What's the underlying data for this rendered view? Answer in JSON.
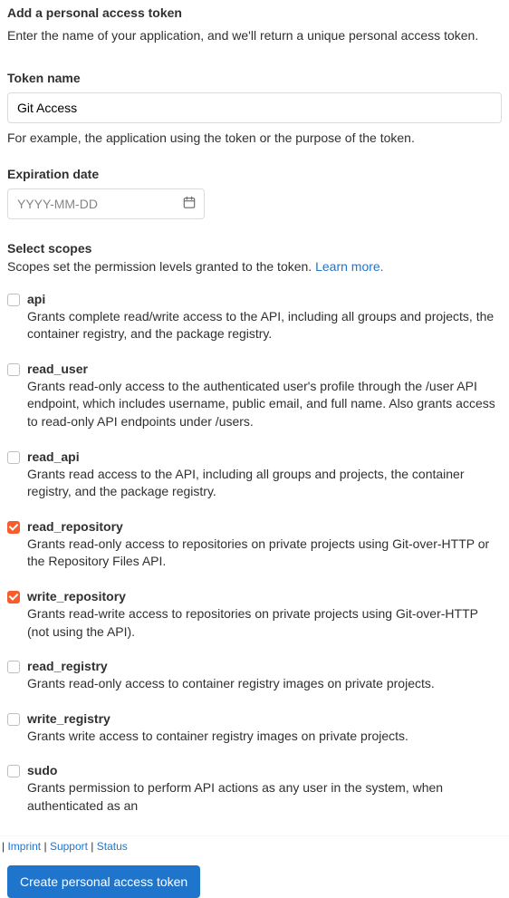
{
  "heading": "Add a personal access token",
  "intro": "Enter the name of your application, and we'll return a unique personal access token.",
  "token_name": {
    "label": "Token name",
    "value": "Git Access",
    "help": "For example, the application using the token or the purpose of the token."
  },
  "expiration": {
    "label": "Expiration date",
    "placeholder": "YYYY-MM-DD"
  },
  "scopes": {
    "label": "Select scopes",
    "desc_prefix": "Scopes set the permission levels granted to the token. ",
    "learn_more": "Learn more.",
    "items": [
      {
        "name": "api",
        "checked": false,
        "desc": "Grants complete read/write access to the API, including all groups and projects, the container registry, and the package registry."
      },
      {
        "name": "read_user",
        "checked": false,
        "desc": "Grants read-only access to the authenticated user's profile through the /user API endpoint, which includes username, public email, and full name. Also grants access to read-only API endpoints under /users."
      },
      {
        "name": "read_api",
        "checked": false,
        "desc": "Grants read access to the API, including all groups and projects, the container registry, and the package registry."
      },
      {
        "name": "read_repository",
        "checked": true,
        "desc": "Grants read-only access to repositories on private projects using Git-over-HTTP or the Repository Files API."
      },
      {
        "name": "write_repository",
        "checked": true,
        "desc": "Grants read-write access to repositories on private projects using Git-over-HTTP (not using the API)."
      },
      {
        "name": "read_registry",
        "checked": false,
        "desc": "Grants read-only access to container registry images on private projects."
      },
      {
        "name": "write_registry",
        "checked": false,
        "desc": "Grants write access to container registry images on private projects."
      },
      {
        "name": "sudo",
        "checked": false,
        "desc": "Grants permission to perform API actions as any user in the system, when authenticated as an"
      }
    ]
  },
  "footer": {
    "imprint": "Imprint",
    "support": "Support",
    "status": "Status"
  },
  "submit": "Create personal access token"
}
